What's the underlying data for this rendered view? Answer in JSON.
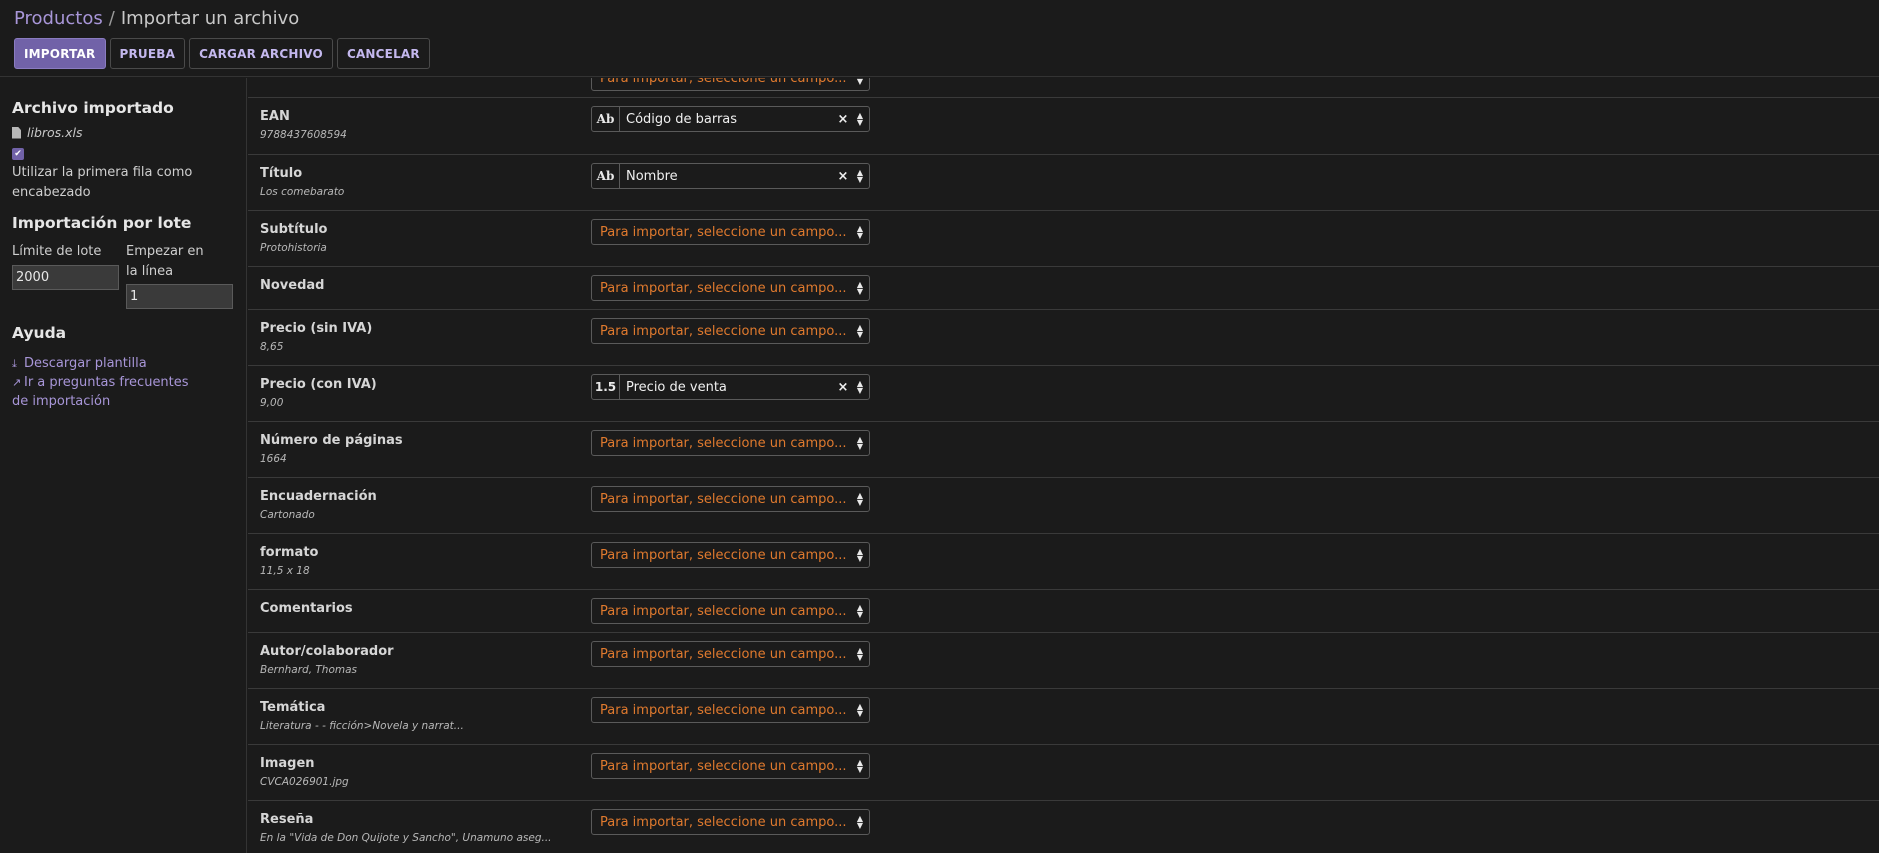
{
  "header": {
    "breadcrumb_parent": "Productos",
    "breadcrumb_separator": "/",
    "breadcrumb_current": "Importar un archivo",
    "buttons": {
      "import": "IMPORTAR",
      "test": "PRUEBA",
      "upload": "CARGAR ARCHIVO",
      "cancel": "CANCELAR"
    }
  },
  "sidebar": {
    "imported_title": "Archivo importado",
    "file_name": "libros.xls",
    "first_row_checked": true,
    "first_row_label": "Utilizar la primera fila como encabezado",
    "batch_title": "Importación por lote",
    "batch_limit_label": "Límite de lote",
    "batch_limit_value": "2000",
    "start_line_label": "Empezar en la línea",
    "start_line_value": "1",
    "help_title": "Ayuda",
    "download_template": "Descargar plantilla",
    "faq_link": "Ir a preguntas frecuentes de importación"
  },
  "placeholder": "Para importar, seleccione un campo...",
  "fields": [
    {
      "name": "EAN",
      "sample": "9788437608594",
      "mapped": "Código de barras",
      "type_badge": "Ab"
    },
    {
      "name": "Título",
      "sample": "Los comebarato",
      "mapped": "Nombre",
      "type_badge": "Ab"
    },
    {
      "name": "Subtítulo",
      "sample": "Protohistoria",
      "mapped": null
    },
    {
      "name": "Novedad",
      "sample": "",
      "mapped": null
    },
    {
      "name": "Precio (sin IVA)",
      "sample": "8,65",
      "mapped": null
    },
    {
      "name": "Precio (con IVA)",
      "sample": "9,00",
      "mapped": "Precio de venta",
      "type_badge": "1.5"
    },
    {
      "name": "Número de páginas",
      "sample": "1664",
      "mapped": null
    },
    {
      "name": "Encuadernación",
      "sample": "Cartonado",
      "mapped": null
    },
    {
      "name": "formato",
      "sample": "11,5 x 18",
      "mapped": null
    },
    {
      "name": "Comentarios",
      "sample": "",
      "mapped": null
    },
    {
      "name": "Autor/colaborador",
      "sample": "Bernhard, Thomas",
      "mapped": null
    },
    {
      "name": "Temática",
      "sample": "Literatura - - ficción>Novela y narrat...",
      "mapped": null
    },
    {
      "name": "Imagen",
      "sample": "CVCA026901.jpg",
      "mapped": null
    },
    {
      "name": "Reseña",
      "sample": "En la \"Vida de Don Quijote y Sancho\", Unamuno aseg...",
      "mapped": null
    }
  ],
  "colors": {
    "accent": "#7162a8",
    "link": "#a896d8",
    "placeholder": "#e07a2e",
    "background": "#1b1b1b"
  }
}
